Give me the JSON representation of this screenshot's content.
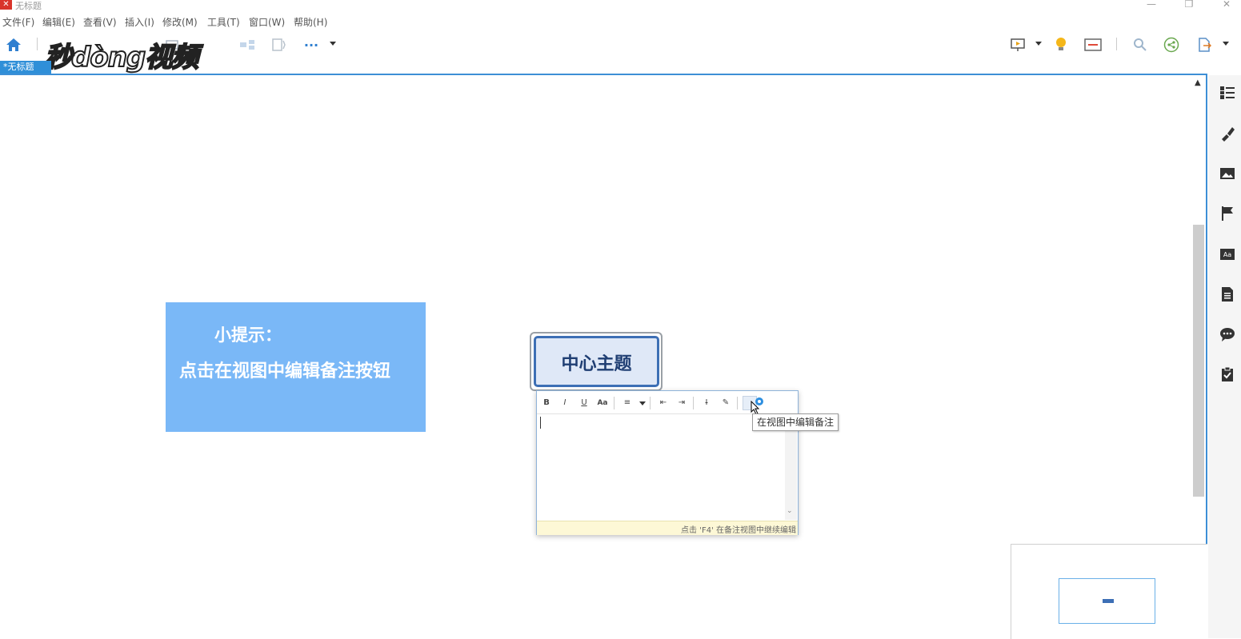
{
  "window": {
    "title": "无标题"
  },
  "menu": [
    "文件(F)",
    "编辑(E)",
    "查看(V)",
    "插入(I)",
    "修改(M)",
    "工具(T)",
    "窗口(W)",
    "帮助(H)"
  ],
  "watermark": "秒dòng视频",
  "tab": {
    "label": "*无标题"
  },
  "hint": {
    "title": "小提示：",
    "body": "点击在视图中编辑备注按钮"
  },
  "topic": {
    "label": "中心主题"
  },
  "notes": {
    "toolbar": [
      "B",
      "I",
      "U",
      "Aa",
      "≡",
      "⇤",
      "⇥",
      "I",
      "✎"
    ],
    "status": "点击 'F4' 在备注视图中继续编辑"
  },
  "tooltip": "在视图中编辑备注",
  "colors": {
    "accent": "#3d8fd6",
    "hint_bg": "#7ab8f7",
    "topic_border": "#3d6fb5",
    "topic_fill": "#dfe8f7"
  },
  "icons": {
    "toolbar_left": [
      "home-icon",
      "more-icon"
    ],
    "toolbar_right": [
      "presentation-icon",
      "idea-icon",
      "pitch-icon",
      "search-icon",
      "share-icon",
      "export-icon"
    ],
    "right_panel": [
      "outline-icon",
      "format-icon",
      "image-icon",
      "marker-icon",
      "style-icon",
      "notes-icon",
      "comments-icon",
      "task-icon"
    ]
  }
}
